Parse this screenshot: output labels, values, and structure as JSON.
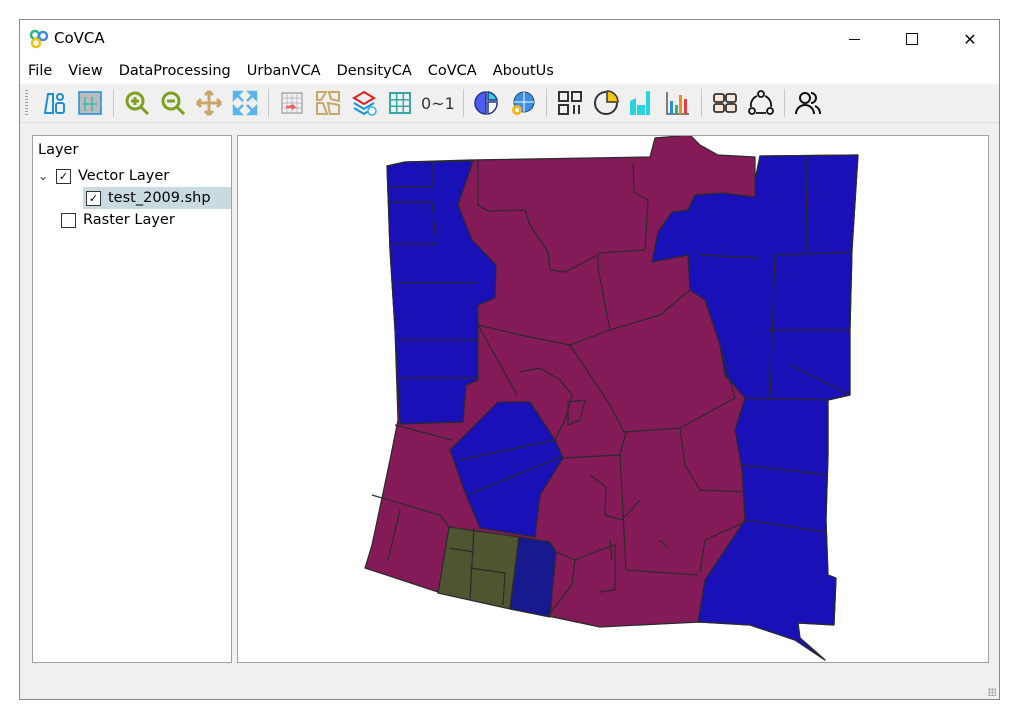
{
  "window": {
    "title": "CoVCA",
    "controls": [
      "minimize",
      "maximize",
      "close"
    ]
  },
  "menu": [
    "File",
    "View",
    "DataProcessing",
    "UrbanVCA",
    "DensityCA",
    "CoVCA",
    "AboutUs"
  ],
  "toolbar": {
    "groups": [
      [
        "layout-panels-icon",
        "grid-view-icon"
      ],
      [
        "zoom-in-icon",
        "zoom-out-icon",
        "pan-icon",
        "full-extent-icon"
      ],
      [
        "raster-export-icon",
        "vector-parcels-icon",
        "layer-stack-icon",
        "grid-icon",
        "normalize-text"
      ],
      [
        "pie-chart-icon",
        "globe-gear-icon"
      ],
      [
        "qr-sort-icon",
        "pie-progress-icon",
        "city-buildings-icon",
        "bar-chart-icon"
      ],
      [
        "modules-icon",
        "cycle-icon"
      ],
      [
        "users-icon"
      ]
    ],
    "normalize_label": "0~1"
  },
  "layers": {
    "title": "Layer",
    "vector": {
      "label": "Vector Layer",
      "checked": true,
      "expanded": true
    },
    "file": {
      "label": "test_2009.shp",
      "checked": true,
      "selected": true
    },
    "raster": {
      "label": "Raster Layer",
      "checked": false
    }
  },
  "map": {
    "colors": {
      "class_a": "#841a58",
      "class_b": "#1a10b8",
      "class_c": "#4f5530",
      "class_d": "#17198e",
      "border": "#2a2a2a"
    }
  }
}
